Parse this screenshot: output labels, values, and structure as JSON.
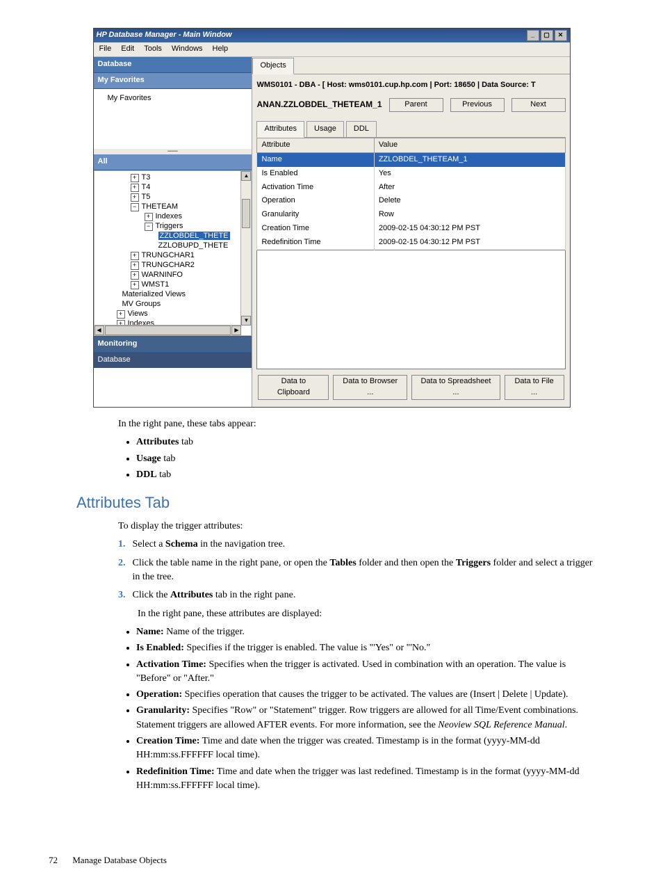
{
  "window": {
    "title": "HP Database Manager - Main Window",
    "menus": [
      "File",
      "Edit",
      "Tools",
      "Windows",
      "Help"
    ],
    "winbtns": {
      "min": "_",
      "max": "▢",
      "close": "✕"
    }
  },
  "left": {
    "database_hdr": "Database",
    "favorites_hdr": "My Favorites",
    "favorites_item": "My Favorites",
    "all_hdr": "All",
    "tree": {
      "t3": "T3",
      "t4": "T4",
      "t5": "T5",
      "theteam": "THETEAM",
      "indexes": "Indexes",
      "triggers": "Triggers",
      "zz_sel": "ZZLOBDEL_THETE",
      "zz2": "ZZLOBUPD_THETE",
      "trungchar1": "TRUNGCHAR1",
      "trungchar2": "TRUNGCHAR2",
      "warninfo": "WARNINFO",
      "wmst1": "WMST1",
      "matviews": "Materialized Views",
      "mvgroups": "MV Groups",
      "views": "Views",
      "indexes2": "Indexes"
    },
    "footer1": "Monitoring",
    "footer2": "Database"
  },
  "right": {
    "objects_tab": "Objects",
    "hostline": "WMS0101 - DBA - [ Host: wms0101.cup.hp.com | Port: 18650 | Data Source: T",
    "path": "ANAN.ZZLOBDEL_THETEAM_1",
    "btn_parent": "Parent",
    "btn_prev": "Previous",
    "btn_next": "Next",
    "tabs": {
      "attributes": "Attributes",
      "usage": "Usage",
      "ddl": "DDL"
    },
    "col_attr": "Attribute",
    "col_val": "Value",
    "rows": [
      {
        "a": "Name",
        "v": "ZZLOBDEL_THETEAM_1",
        "hl": true
      },
      {
        "a": "Is Enabled",
        "v": "Yes"
      },
      {
        "a": "Activation Time",
        "v": "After"
      },
      {
        "a": "Operation",
        "v": "Delete"
      },
      {
        "a": "Granularity",
        "v": "Row"
      },
      {
        "a": "Creation Time",
        "v": "2009-02-15 04:30:12 PM PST"
      },
      {
        "a": "Redefinition Time",
        "v": "2009-02-15 04:30:12 PM PST"
      }
    ],
    "btns": {
      "clipboard": "Data to Clipboard",
      "browser": "Data to Browser ...",
      "spreadsheet": "Data to Spreadsheet ...",
      "file": "Data to File ..."
    }
  },
  "doc": {
    "intro_tabs": "In the right pane, these tabs appear:",
    "tabs_list": [
      {
        "b": "Attributes",
        "t": " tab"
      },
      {
        "b": "Usage",
        "t": " tab"
      },
      {
        "b": "DDL",
        "t": " tab"
      }
    ],
    "h2": "Attributes Tab",
    "intro2": "To display the trigger attributes:",
    "steps": {
      "s1a": "Select a ",
      "s1b": "Schema",
      "s1c": " in the navigation tree.",
      "s2a": "Click the table name in the right pane, or open the ",
      "s2b": "Tables",
      "s2c": " folder and then open the ",
      "s2d": "Triggers",
      "s2e": " folder and select a trigger in the tree.",
      "s3a": "Click the ",
      "s3b": "Attributes",
      "s3c": " tab in the right pane.",
      "s3_after": "In the right pane, these attributes are displayed:"
    },
    "attrs": {
      "name_b": "Name:",
      "name_t": " Name of the trigger.",
      "enabled_b": "Is Enabled:",
      "enabled_t": " Specifies if the trigger is enabled. The value is \"'Yes\" or \"'No.\"",
      "act_b": "Activation Time:",
      "act_t": " Specifies when the trigger is activated. Used in combination with an operation. The value is \"Before\" or \"After.\"",
      "op_b": "Operation:",
      "op_t": " Specifies operation that causes the trigger to be activated. The values are (Insert | Delete | Update).",
      "gran_b": "Granularity:",
      "gran_t1": " Specifies \"Row\" or \"Statement\" trigger. Row triggers are allowed for all Time/Event combinations. Statement triggers are allowed AFTER events. For more information, see the ",
      "gran_ital": "Neoview SQL Reference Manual",
      "gran_t2": ".",
      "ct_b": "Creation Time:",
      "ct_t": " Time and date when the trigger was created. Timestamp is in the format (yyyy-MM-dd HH:mm:ss.FFFFFF local time).",
      "rt_b": "Redefinition Time:",
      "rt_t": " Time and date when the trigger was last redefined. Timestamp is in the format (yyyy-MM-dd HH:mm:ss.FFFFFF local time)."
    }
  },
  "footer": {
    "page": "72",
    "chapter": "Manage Database Objects"
  }
}
